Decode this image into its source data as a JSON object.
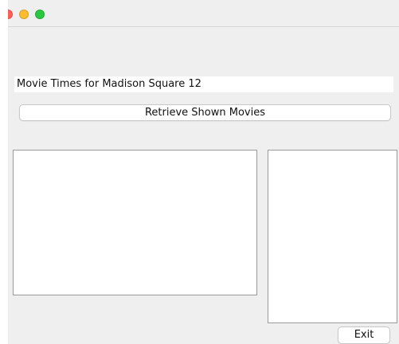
{
  "window": {
    "traffic_lights": {
      "close_color": "#ff5f57",
      "minimize_color": "#febc2e",
      "zoom_color": "#28c840"
    }
  },
  "main": {
    "title_field": "Movie Times for Madison Square 12",
    "retrieve_button_label": "Retrieve Shown Movies",
    "movies_list_items": [],
    "times_list_items": [],
    "exit_button_label": "Exit"
  }
}
